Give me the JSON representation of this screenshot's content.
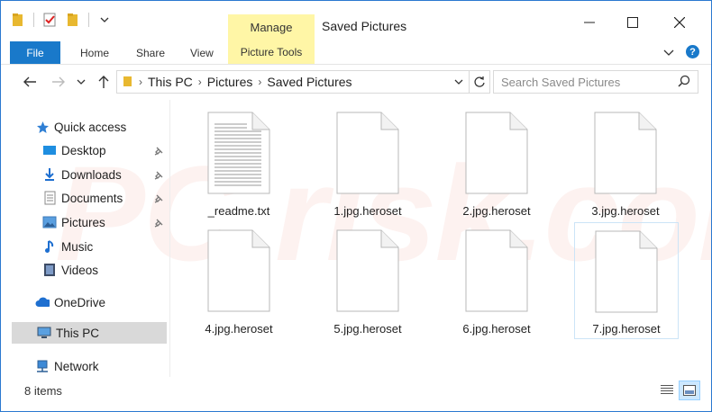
{
  "window": {
    "title": "Saved Pictures",
    "manage_label": "Manage"
  },
  "ribbon": {
    "file_label": "File",
    "tabs": [
      "Home",
      "Share",
      "View"
    ],
    "picture_tools_label": "Picture Tools",
    "help_label": "?"
  },
  "address": {
    "crumbs": [
      "This PC",
      "Pictures",
      "Saved Pictures"
    ],
    "search_placeholder": "Search Saved Pictures"
  },
  "sidebar": {
    "items": [
      {
        "label": "Quick access",
        "icon": "star-icon"
      },
      {
        "label": "Desktop",
        "icon": "desktop-folder-icon",
        "pinned": true
      },
      {
        "label": "Downloads",
        "icon": "downloads-folder-icon",
        "pinned": true
      },
      {
        "label": "Documents",
        "icon": "documents-folder-icon",
        "pinned": true
      },
      {
        "label": "Pictures",
        "icon": "pictures-folder-icon",
        "pinned": true
      },
      {
        "label": "Music",
        "icon": "music-icon"
      },
      {
        "label": "Videos",
        "icon": "videos-icon"
      },
      {
        "label": "OneDrive",
        "icon": "cloud-icon"
      },
      {
        "label": "This PC",
        "icon": "computer-icon",
        "selected": true
      },
      {
        "label": "Network",
        "icon": "network-icon"
      }
    ]
  },
  "files": [
    {
      "name": "_readme.txt",
      "type": "text"
    },
    {
      "name": "1.jpg.heroset",
      "type": "blank"
    },
    {
      "name": "2.jpg.heroset",
      "type": "blank"
    },
    {
      "name": "3.jpg.heroset",
      "type": "blank"
    },
    {
      "name": "4.jpg.heroset",
      "type": "blank"
    },
    {
      "name": "5.jpg.heroset",
      "type": "blank"
    },
    {
      "name": "6.jpg.heroset",
      "type": "blank"
    },
    {
      "name": "7.jpg.heroset",
      "type": "blank",
      "selected": true
    }
  ],
  "status": {
    "item_count": "8 items"
  },
  "watermark": {
    "text": "PC risk.com"
  },
  "colors": {
    "accent": "#1979ca",
    "picture_tools": "#fff6a6",
    "selection": "#d9d9d9"
  }
}
